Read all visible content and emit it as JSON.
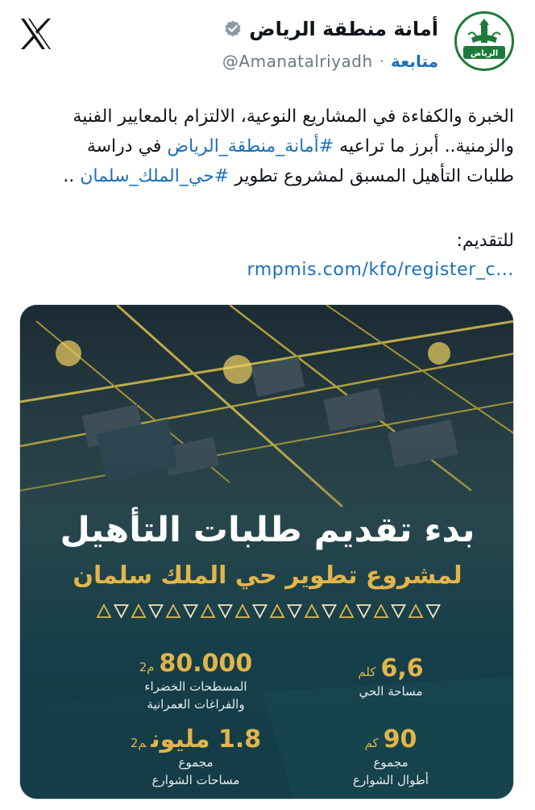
{
  "account": {
    "name": "أمانة منطقة الرياض",
    "handle": "@Amanatalriyadh",
    "follow_label": "متابعة",
    "separator": "·",
    "avatar_text": "الرياض"
  },
  "tweet": {
    "line1": "الخبرة والكفاءة في المشاريع النوعية، الالتزام بالمعايير الفنية",
    "line2_a": "والزمنية.. أبرز ما تراعيه ",
    "line2_hashtag": "#أمانة_منطقة_الرياض",
    "line2_b": " في دراسة",
    "line3_a": "طلبات التأهيل المسبق لمشروع تطوير ",
    "line3_hashtag": "#حي_الملك_سلمان",
    "line3_b": " ..",
    "apply_label": "للتقديم:",
    "link": "rmpmis.com/kfo/register_c..."
  },
  "card": {
    "headline": "بدء تقديم طلبات التأهيل",
    "subline": "لمشروع تطوير حي الملك سلمان",
    "stats": [
      {
        "value": "6,6",
        "unit": "كلم",
        "label1": "مساحة الحي",
        "label2": ""
      },
      {
        "value": "80.000",
        "unit": "م2",
        "label1": "المسطحات الخضراء",
        "label2": "والفراغات العمرانية"
      },
      {
        "value": "90",
        "unit": "كم",
        "label1": "مجموع",
        "label2": "أطوال الشوارع"
      },
      {
        "value": "1.8 مليون",
        "unit": "م2",
        "label1": "مجموع",
        "label2": "مساحات الشوارع"
      }
    ]
  },
  "icons": {
    "x_logo": "x-logo-icon",
    "verified": "verified-badge-icon"
  },
  "colors": {
    "link": "#1d6fb8",
    "gold": "#e2b54a",
    "card_bg": "#143a44",
    "brand_green": "#1e7a3a"
  }
}
